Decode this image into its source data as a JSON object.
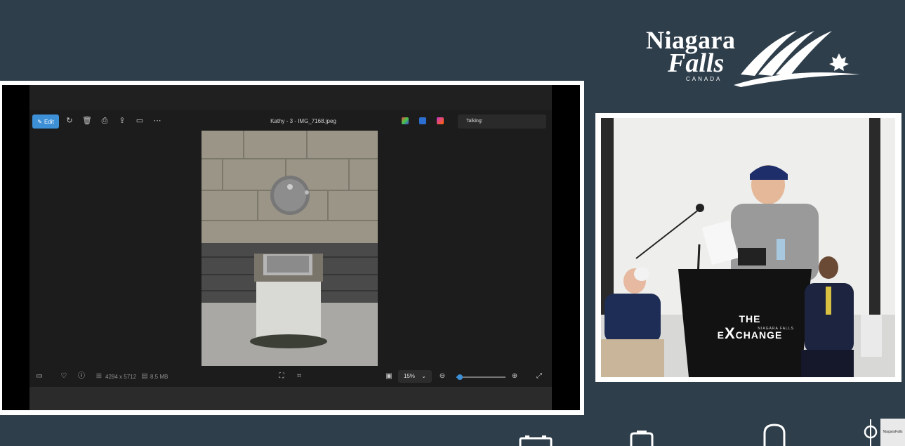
{
  "logo": {
    "line1": "Niagara",
    "line2": "Falls",
    "line3": "CANADA"
  },
  "photos_app": {
    "edit_label": "Edit",
    "file_title": "Kathy - 3 - IMG_7168.jpeg",
    "talking_label": "Talking:",
    "dimensions": "4284 x 5712",
    "file_size": "8.5 MB",
    "zoom_value": "15%",
    "zoom_level": 0.05,
    "toolbar_icons": [
      "rotate-icon",
      "delete-icon",
      "print-icon",
      "share-icon",
      "slideshow-icon",
      "more-icon"
    ],
    "colors": {
      "accent": "#3d8fd6",
      "background": "#1c1c1c"
    }
  },
  "podium": {
    "brand_prefix": "THE E",
    "brand_x": "X",
    "brand_suffix": "CHANGE",
    "brand_sub": "NIAGARA FALLS"
  },
  "corner_logo": "NiagaraFalls",
  "colors": {
    "page_background": "#2e3e4b"
  }
}
